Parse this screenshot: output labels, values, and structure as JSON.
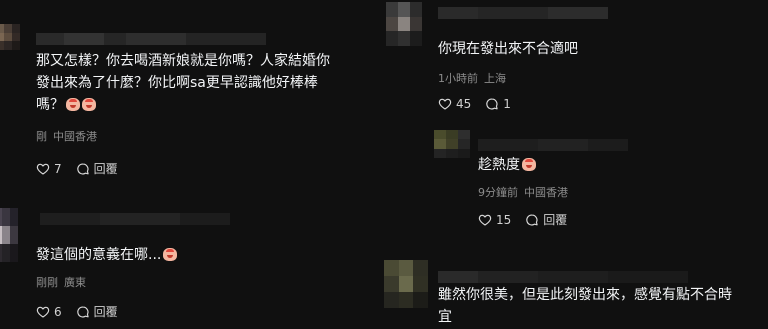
{
  "left": {
    "comments": [
      {
        "text": "那又怎樣？你去喝酒新娘就是你嗎？人家結婚你\n發出來為了什麼？你比啊sa更早認識他好棒棒\n嗎？",
        "time": "剛",
        "location": "中國香港",
        "likes": "7",
        "reply_label": "回覆"
      },
      {
        "text": "發這個的意義在哪...",
        "time": "剛剛",
        "location": "廣東",
        "likes": "6",
        "reply_label": "回覆"
      }
    ]
  },
  "right": {
    "comments": [
      {
        "text": "你現在發出來不合適吧",
        "time": "1小時前",
        "location": "上海",
        "likes": "45",
        "replies": "1"
      },
      {
        "text": "趁熱度",
        "time": "9分鐘前",
        "location": "中國香港",
        "likes": "15",
        "reply_label": "回覆"
      },
      {
        "text": "雖然你很美，但是此刻發出來，感覺有點不合時\n宜"
      }
    ]
  }
}
